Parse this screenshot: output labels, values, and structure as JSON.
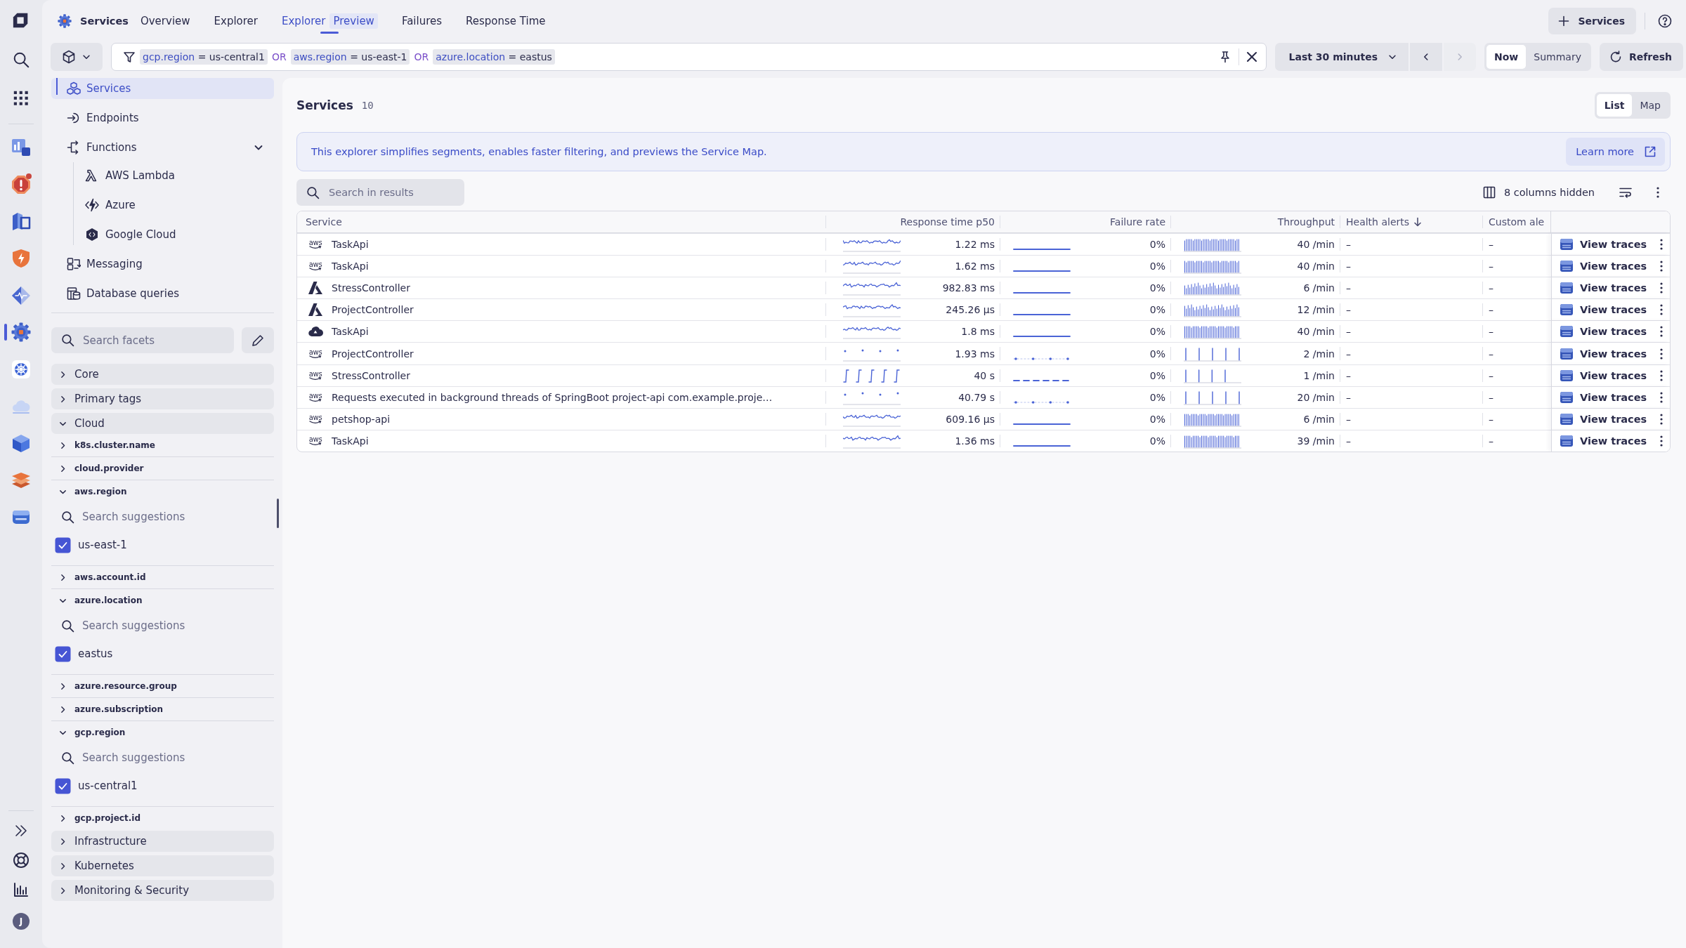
{
  "rail": {
    "apps": [
      {
        "kind": "chart",
        "selected": false,
        "alert": false
      },
      {
        "kind": "alert",
        "selected": false,
        "alert": true
      },
      {
        "kind": "cubes",
        "selected": false,
        "alert": false
      },
      {
        "kind": "shield",
        "selected": false,
        "alert": false
      },
      {
        "kind": "pulse",
        "selected": false,
        "alert": false
      },
      {
        "kind": "gear",
        "selected": true,
        "alert": false
      },
      {
        "kind": "wheel",
        "selected": false,
        "alert": false
      },
      {
        "kind": "cloud",
        "selected": false,
        "alert": false
      },
      {
        "kind": "box",
        "selected": false,
        "alert": false
      },
      {
        "kind": "layers",
        "selected": false,
        "alert": false
      },
      {
        "kind": "drive",
        "selected": false,
        "alert": false
      }
    ],
    "avatar": "J"
  },
  "header": {
    "app_title": "Services",
    "tabs": [
      {
        "label": "Overview",
        "selected": false
      },
      {
        "label": "Explorer",
        "selected": false
      },
      {
        "label": "Explorer",
        "badge": "Preview",
        "selected": true
      },
      {
        "label": "Failures",
        "selected": false
      },
      {
        "label": "Response Time",
        "selected": false
      }
    ],
    "add_button": "Services"
  },
  "filter_bar": {
    "query": [
      {
        "kind": "term",
        "key": "gcp.region",
        "operator": "=",
        "value": "us-central1"
      },
      {
        "kind": "connector",
        "text": "OR"
      },
      {
        "kind": "term",
        "key": "aws.region",
        "operator": "=",
        "value": "us-east-1"
      },
      {
        "kind": "connector",
        "text": "OR"
      },
      {
        "kind": "term",
        "key": "azure.location",
        "operator": "=",
        "value": "eastus"
      }
    ],
    "timeframe": "Last 30 minutes",
    "time_nav": [
      {
        "kind": "previous",
        "disabled": false
      },
      {
        "kind": "next",
        "disabled": true
      }
    ],
    "mode": [
      {
        "label": "Now",
        "selected": true
      },
      {
        "label": "Summary",
        "selected": false
      }
    ],
    "refresh": "Refresh"
  },
  "sidebar": {
    "nav": [
      {
        "kind": "cubes",
        "label": "Services",
        "selected": true
      },
      {
        "kind": "endpoint",
        "label": "Endpoints",
        "selected": false
      },
      {
        "kind": "function",
        "label": "Functions",
        "selected": false,
        "expanded": true,
        "children": [
          {
            "kind": "lambda",
            "label": "AWS Lambda",
            "selected": false
          },
          {
            "kind": "bolt",
            "label": "Azure",
            "selected": false
          },
          {
            "kind": "hexagon",
            "label": "Google Cloud",
            "selected": false
          }
        ]
      },
      {
        "kind": "messaging",
        "label": "Messaging",
        "selected": false
      },
      {
        "kind": "database",
        "label": "Database queries",
        "selected": false
      }
    ],
    "facets": {
      "search": {
        "placeholder": "Search facets"
      },
      "groups": [
        {
          "label": "Core",
          "expanded": false
        },
        {
          "label": "Primary tags",
          "expanded": false
        },
        {
          "label": "Cloud",
          "expanded": true,
          "children": [
            {
              "label": "k8s.cluster.name",
              "expanded": false
            },
            {
              "label": "cloud.provider",
              "expanded": false
            },
            {
              "label": "aws.region",
              "expanded": true,
              "search": {
                "placeholder": "Search suggestions"
              },
              "options": [
                {
                  "label": "us-east-1",
                  "checked": true
                }
              ]
            },
            {
              "label": "aws.account.id",
              "expanded": false
            },
            {
              "label": "azure.location",
              "expanded": true,
              "search": {
                "placeholder": "Search suggestions"
              },
              "options": [
                {
                  "label": "eastus",
                  "checked": true
                }
              ]
            },
            {
              "label": "azure.resource.group",
              "expanded": false
            },
            {
              "label": "azure.subscription",
              "expanded": false
            },
            {
              "label": "gcp.region",
              "expanded": true,
              "search": {
                "placeholder": "Search suggestions"
              },
              "options": [
                {
                  "label": "us-central1",
                  "checked": true
                }
              ]
            },
            {
              "label": "gcp.project.id",
              "expanded": false
            }
          ]
        },
        {
          "label": "Infrastructure",
          "expanded": false
        },
        {
          "label": "Kubernetes",
          "expanded": false
        },
        {
          "label": "Monitoring & Security",
          "expanded": false
        }
      ]
    }
  },
  "main": {
    "title": "Services",
    "count": "10",
    "view_toggle": [
      {
        "label": "List",
        "selected": true
      },
      {
        "label": "Map",
        "selected": false
      }
    ],
    "banner": {
      "text": "This explorer simplifies segments, enables faster filtering, and previews the Service Map.",
      "button": "Learn more"
    },
    "search": {
      "placeholder": "Search in results"
    },
    "hidden_columns": "8 columns hidden",
    "table": {
      "columns": [
        {
          "label": "Service",
          "sorted": false
        },
        {
          "label": "Response time p50",
          "sorted": false
        },
        {
          "label": "Failure rate",
          "sorted": false
        },
        {
          "label": "Throughput",
          "sorted": false
        },
        {
          "label": "Health alerts",
          "sorted": true
        },
        {
          "label": "Custom ale",
          "sorted": false
        }
      ],
      "rows": [
        {
          "kind": "wordmark",
          "logo": "aws",
          "service": "TaskApi",
          "response_time": "1.22 ms",
          "failure_rate": "0%",
          "throughput": "40 /min",
          "health_alerts": "–",
          "column_6": "–",
          "action": "View traces",
          "trends": [
            {
              "kind": "wave"
            },
            {
              "kind": "flat"
            },
            {
              "kind": "dense"
            }
          ]
        },
        {
          "kind": "wordmark",
          "logo": "aws",
          "service": "TaskApi",
          "response_time": "1.62 ms",
          "failure_rate": "0%",
          "throughput": "40 /min",
          "health_alerts": "–",
          "column_6": "–",
          "action": "View traces",
          "trends": [
            {
              "kind": "wave"
            },
            {
              "kind": "flat"
            },
            {
              "kind": "dense"
            }
          ]
        },
        {
          "kind": "letter",
          "service": "StressController",
          "response_time": "982.83 ms",
          "failure_rate": "0%",
          "throughput": "6 /min",
          "health_alerts": "–",
          "column_6": "–",
          "action": "View traces",
          "trends": [
            {
              "kind": "wave"
            },
            {
              "kind": "flat"
            },
            {
              "kind": "varied"
            }
          ]
        },
        {
          "kind": "letter",
          "service": "ProjectController",
          "response_time": "245.26 µs",
          "failure_rate": "0%",
          "throughput": "12 /min",
          "health_alerts": "–",
          "column_6": "–",
          "action": "View traces",
          "trends": [
            {
              "kind": "wave"
            },
            {
              "kind": "flat"
            },
            {
              "kind": "varied"
            }
          ]
        },
        {
          "kind": "cloud",
          "service": "TaskApi",
          "response_time": "1.8 ms",
          "failure_rate": "0%",
          "throughput": "40 /min",
          "health_alerts": "–",
          "column_6": "–",
          "action": "View traces",
          "trends": [
            {
              "kind": "wave"
            },
            {
              "kind": "flat"
            },
            {
              "kind": "dense"
            }
          ]
        },
        {
          "kind": "wordmark",
          "logo": "aws",
          "service": "ProjectController",
          "response_time": "1.93 ms",
          "failure_rate": "0%",
          "throughput": "2 /min",
          "health_alerts": "–",
          "column_6": "–",
          "action": "View traces",
          "trends": [
            {
              "kind": "dots"
            },
            {
              "kind": "dotline"
            },
            {
              "kind": "spikes"
            }
          ]
        },
        {
          "kind": "wordmark",
          "logo": "aws",
          "service": "StressController",
          "response_time": "40 s",
          "failure_rate": "0%",
          "throughput": "1 /min",
          "health_alerts": "–",
          "column_6": "–",
          "action": "View traces",
          "trends": [
            {
              "kind": "steps"
            },
            {
              "kind": "dashes"
            },
            {
              "kind": "spikes"
            }
          ]
        },
        {
          "kind": "wordmark",
          "logo": "aws",
          "service": "Requests executed in background threads of SpringBoot project-api com.example.proje…",
          "response_time": "40.79 s",
          "failure_rate": "0%",
          "throughput": "20 /min",
          "health_alerts": "–",
          "column_6": "–",
          "action": "View traces",
          "trends": [
            {
              "kind": "dots"
            },
            {
              "kind": "dotline"
            },
            {
              "kind": "spikes"
            }
          ]
        },
        {
          "kind": "wordmark",
          "logo": "aws",
          "service": "petshop-api",
          "response_time": "609.16 µs",
          "failure_rate": "0%",
          "throughput": "6 /min",
          "health_alerts": "–",
          "column_6": "–",
          "action": "View traces",
          "trends": [
            {
              "kind": "wave"
            },
            {
              "kind": "flat"
            },
            {
              "kind": "dense"
            }
          ]
        },
        {
          "kind": "wordmark",
          "logo": "aws",
          "service": "TaskApi",
          "response_time": "1.36 ms",
          "failure_rate": "0%",
          "throughput": "39 /min",
          "health_alerts": "–",
          "column_6": "–",
          "action": "View traces",
          "trends": [
            {
              "kind": "wave"
            },
            {
              "kind": "flat"
            },
            {
              "kind": "dense"
            }
          ]
        }
      ]
    }
  }
}
